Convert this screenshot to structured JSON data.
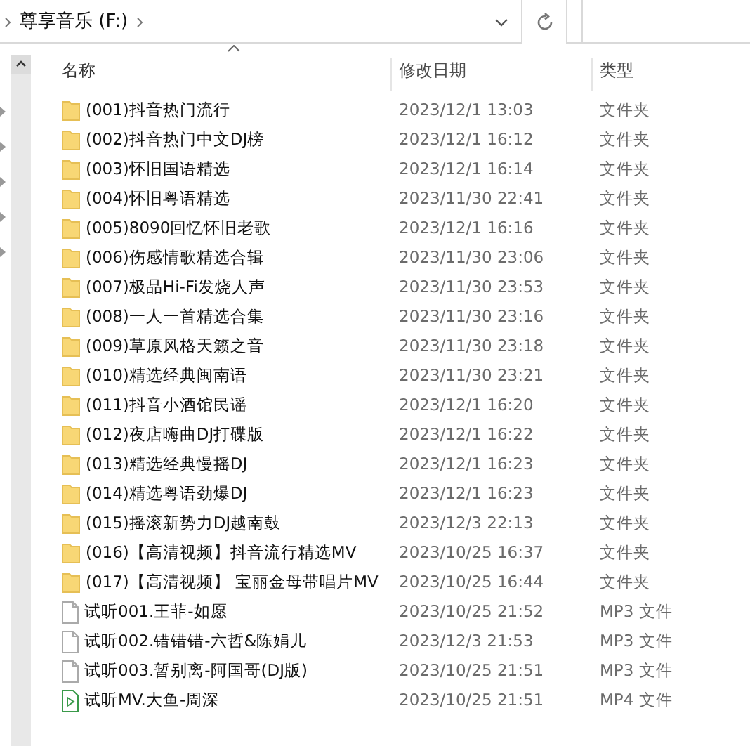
{
  "address_bar": {
    "path": "尊享音乐 (F:)"
  },
  "columns": [
    {
      "label": "名称",
      "sorted": true
    },
    {
      "label": "修改日期",
      "sorted": false
    },
    {
      "label": "类型",
      "sorted": false
    }
  ],
  "files": [
    {
      "kind": "folder",
      "name": "(001)抖音热门流行",
      "modified": "2023/12/1 13:03",
      "type": "文件夹"
    },
    {
      "kind": "folder",
      "name": "(002)抖音热门中文DJ榜",
      "modified": "2023/12/1 16:12",
      "type": "文件夹"
    },
    {
      "kind": "folder",
      "name": "(003)怀旧国语精选",
      "modified": "2023/12/1 16:14",
      "type": "文件夹"
    },
    {
      "kind": "folder",
      "name": "(004)怀旧粤语精选",
      "modified": "2023/11/30 22:41",
      "type": "文件夹"
    },
    {
      "kind": "folder",
      "name": "(005)8090回忆怀旧老歌",
      "modified": "2023/12/1 16:16",
      "type": "文件夹"
    },
    {
      "kind": "folder",
      "name": "(006)伤感情歌精选合辑",
      "modified": "2023/11/30 23:06",
      "type": "文件夹"
    },
    {
      "kind": "folder",
      "name": "(007)极品Hi-Fi发烧人声",
      "modified": "2023/11/30 23:53",
      "type": "文件夹"
    },
    {
      "kind": "folder",
      "name": "(008)一人一首精选合集",
      "modified": "2023/11/30 23:16",
      "type": "文件夹"
    },
    {
      "kind": "folder",
      "name": "(009)草原风格天籁之音",
      "modified": "2023/11/30 23:18",
      "type": "文件夹"
    },
    {
      "kind": "folder",
      "name": "(010)精选经典闽南语",
      "modified": "2023/11/30 23:21",
      "type": "文件夹"
    },
    {
      "kind": "folder",
      "name": "(011)抖音小酒馆民谣",
      "modified": "2023/12/1 16:20",
      "type": "文件夹"
    },
    {
      "kind": "folder",
      "name": "(012)夜店嗨曲DJ打碟版",
      "modified": "2023/12/1 16:22",
      "type": "文件夹"
    },
    {
      "kind": "folder",
      "name": "(013)精选经典慢摇DJ",
      "modified": "2023/12/1 16:23",
      "type": "文件夹"
    },
    {
      "kind": "folder",
      "name": "(014)精选粤语劲爆DJ",
      "modified": "2023/12/1 16:23",
      "type": "文件夹"
    },
    {
      "kind": "folder",
      "name": "(015)摇滚新势力DJ越南鼓",
      "modified": "2023/12/3 22:13",
      "type": "文件夹"
    },
    {
      "kind": "folder",
      "name": "(016)【高清视频】抖音流行精选MV",
      "modified": "2023/10/25 16:37",
      "type": "文件夹"
    },
    {
      "kind": "folder",
      "name": "(017)【高清视频】 宝丽金母带唱片MV",
      "modified": "2023/10/25 16:44",
      "type": "文件夹"
    },
    {
      "kind": "file",
      "name": "试听001.王菲-如愿",
      "modified": "2023/10/25 21:52",
      "type": "MP3 文件"
    },
    {
      "kind": "file",
      "name": "试听002.错错错-六哲&陈娟儿",
      "modified": "2023/12/3 21:53",
      "type": "MP3 文件"
    },
    {
      "kind": "file",
      "name": "试听003.暂别离-阿国哥(DJ版)",
      "modified": "2023/10/25 21:51",
      "type": "MP3 文件"
    },
    {
      "kind": "video",
      "name": "试听MV.大鱼-周深",
      "modified": "2023/10/25 21:51",
      "type": "MP4 文件"
    }
  ]
}
